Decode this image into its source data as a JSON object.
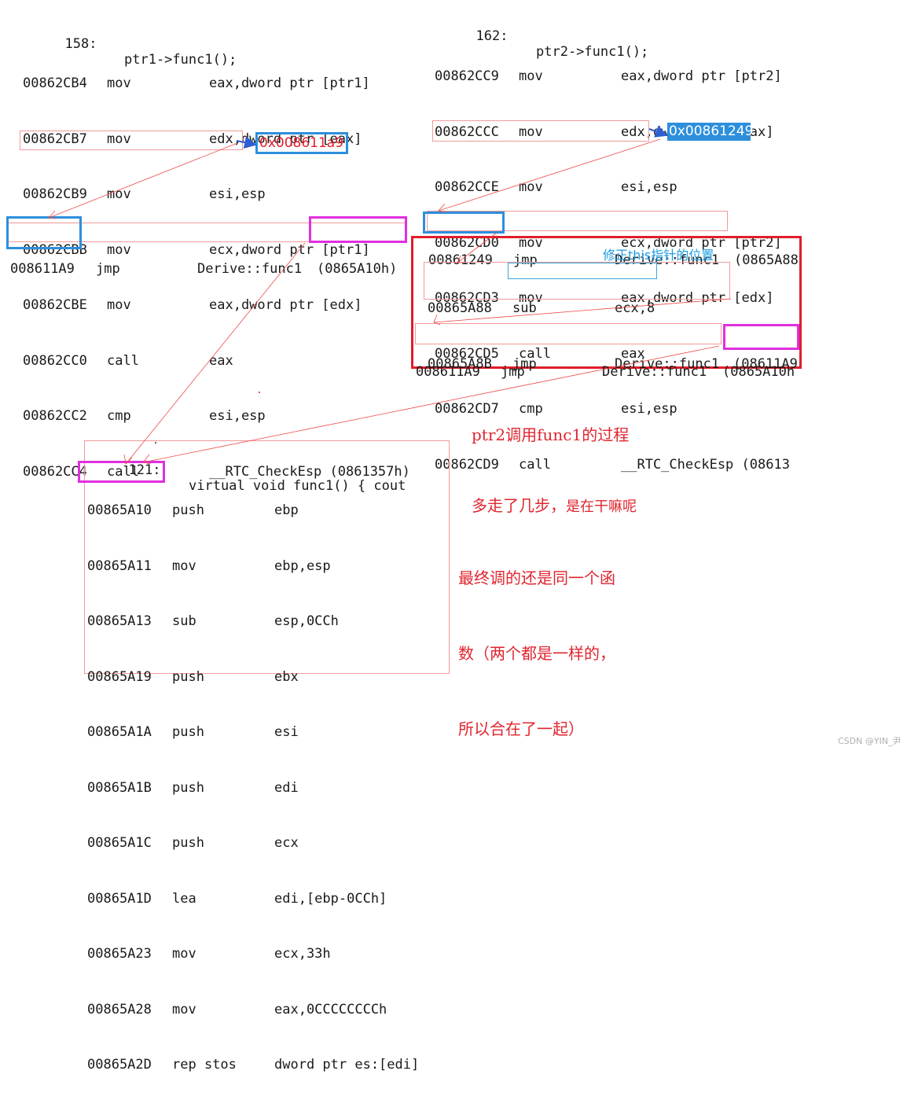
{
  "left_call": {
    "title_no": "158:",
    "title_src": "ptr1->func1();",
    "rows": [
      {
        "addr": "00862CB4",
        "op": "mov",
        "args": "eax,dword ptr [ptr1]"
      },
      {
        "addr": "00862CB7",
        "op": "mov",
        "args": "edx,dword ptr [eax]"
      },
      {
        "addr": "00862CB9",
        "op": "mov",
        "args": "esi,esp"
      },
      {
        "addr": "00862CBB",
        "op": "mov",
        "args": "ecx,dword ptr [ptr1]"
      },
      {
        "addr": "00862CBE",
        "op": "mov",
        "args": "eax,dword ptr [edx]"
      },
      {
        "addr": "00862CC0",
        "op": "call",
        "args": "eax"
      },
      {
        "addr": "00862CC2",
        "op": "cmp",
        "args": "esi,esp"
      },
      {
        "addr": "00862CC4",
        "op": "call",
        "args": "__RTC_CheckEsp (0861357h)"
      }
    ],
    "eax_value": "0x008611a9"
  },
  "right_call": {
    "title_no": "162:",
    "title_src": "ptr2->func1();",
    "rows": [
      {
        "addr": "00862CC9",
        "op": "mov",
        "args": "eax,dword ptr [ptr2]"
      },
      {
        "addr": "00862CCC",
        "op": "mov",
        "args": "edx,dword ptr [eax]"
      },
      {
        "addr": "00862CCE",
        "op": "mov",
        "args": "esi,esp"
      },
      {
        "addr": "00862CD0",
        "op": "mov",
        "args": "ecx,dword ptr [ptr2]"
      },
      {
        "addr": "00862CD3",
        "op": "mov",
        "args": "eax,dword ptr [edx]"
      },
      {
        "addr": "00862CD5",
        "op": "call",
        "args": "eax"
      },
      {
        "addr": "00862CD7",
        "op": "cmp",
        "args": "esi,esp"
      },
      {
        "addr": "00862CD9",
        "op": "call",
        "args": "__RTC_CheckEsp (08613"
      }
    ],
    "eax_value": "0x00861249"
  },
  "left_jmp": {
    "addr": "008611A9",
    "op": "jmp",
    "args": "Derive::func1",
    "target": "(0865A10h)"
  },
  "right_jmp": {
    "addr": "00861249",
    "op": "jmp",
    "args": "Derive::func1",
    "target": "(0865A88"
  },
  "thunk": {
    "label": "修正this指针的位置",
    "rows": [
      {
        "addr": "00865A88",
        "op": "sub",
        "args": "ecx,8",
        "extra": ""
      },
      {
        "addr": "00865A8B",
        "op": "jmp",
        "args": "Derive::func1",
        "extra": "(08611A9"
      }
    ],
    "jmp2": {
      "addr": "008611A9",
      "op": "jmp",
      "args": "Derive::func1",
      "target": "(0865A10h"
    }
  },
  "note_ptr2": {
    "line1": "ptr2调用func1的过程",
    "line2a": "多走了几步，",
    "line2b": "是在干嘛呢"
  },
  "func_body": {
    "title_no": "121:",
    "title_src": "virtual void func1() { cout",
    "rows": [
      {
        "addr": "00865A10",
        "op": "push",
        "args": "ebp"
      },
      {
        "addr": "00865A11",
        "op": "mov",
        "args": "ebp,esp"
      },
      {
        "addr": "00865A13",
        "op": "sub",
        "args": "esp,0CCh"
      },
      {
        "addr": "00865A19",
        "op": "push",
        "args": "ebx"
      },
      {
        "addr": "00865A1A",
        "op": "push",
        "args": "esi"
      },
      {
        "addr": "00865A1B",
        "op": "push",
        "args": "edi"
      },
      {
        "addr": "00865A1C",
        "op": "push",
        "args": "ecx"
      },
      {
        "addr": "00865A1D",
        "op": "lea",
        "args": "edi,[ebp-0CCh]"
      },
      {
        "addr": "00865A23",
        "op": "mov",
        "args": "ecx,33h"
      },
      {
        "addr": "00865A28",
        "op": "mov",
        "args": "eax,0CCCCCCCCh"
      },
      {
        "addr": "00865A2D",
        "op": "rep stos",
        "args": "dword ptr es:[edi]"
      }
    ]
  },
  "note_final": {
    "line1": "最终调的还是同一个函",
    "line2": "数（两个都是一样的，",
    "line3": "所以合在了一起）"
  },
  "watermark": "CSDN @YIN_尹",
  "colors": {
    "red": "#e01d2b",
    "blue": "#2d8fdc",
    "magenta": "#e12fe0",
    "pink": "#f19a9a"
  }
}
